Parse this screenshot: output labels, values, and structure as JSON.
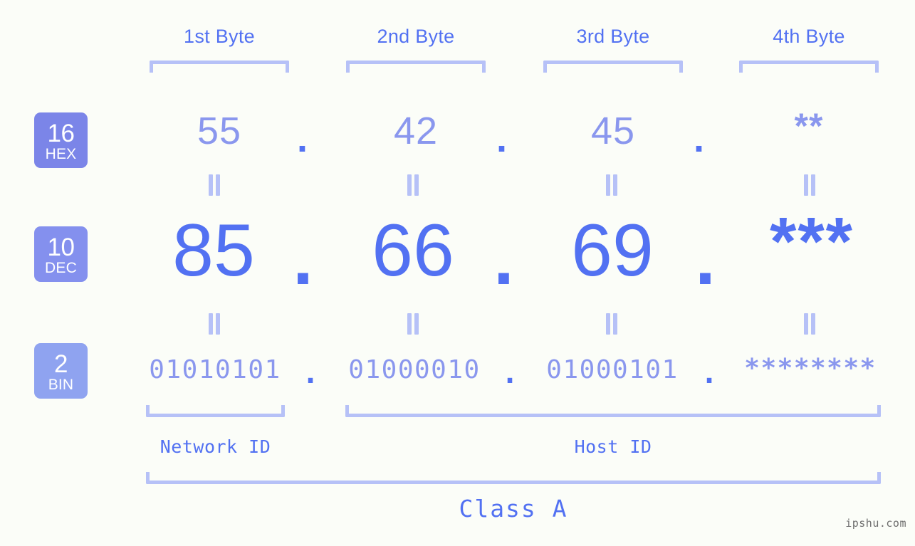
{
  "background_color": "#fbfdf8",
  "accent_color": "#5271f2",
  "accent_light_color": "#8a97ee",
  "bracket_color": "#b6c1f7",
  "byte_headers": [
    {
      "label": "1st Byte"
    },
    {
      "label": "2nd Byte"
    },
    {
      "label": "3rd Byte"
    },
    {
      "label": "4th Byte"
    }
  ],
  "rows": [
    {
      "badge_number": "16",
      "badge_name": "HEX",
      "badge_color": "#7b85e8",
      "values": [
        "55",
        "42",
        "45",
        "**"
      ],
      "separators": [
        ".",
        ".",
        "."
      ]
    },
    {
      "badge_number": "10",
      "badge_name": "DEC",
      "badge_color": "#8490ee",
      "values": [
        "85",
        "66",
        "69",
        "***"
      ],
      "separators": [
        ".",
        ".",
        "."
      ]
    },
    {
      "badge_number": "2",
      "badge_name": "BIN",
      "badge_color": "#8fa3f0",
      "values": [
        "01010101",
        "01000010",
        "01000101",
        "********"
      ],
      "separators": [
        ".",
        ".",
        "."
      ]
    }
  ],
  "equals_marker": "||",
  "id_sections": [
    {
      "label": "Network ID"
    },
    {
      "label": "Host ID"
    }
  ],
  "class_label": "Class A",
  "watermark": "ipshu.com"
}
